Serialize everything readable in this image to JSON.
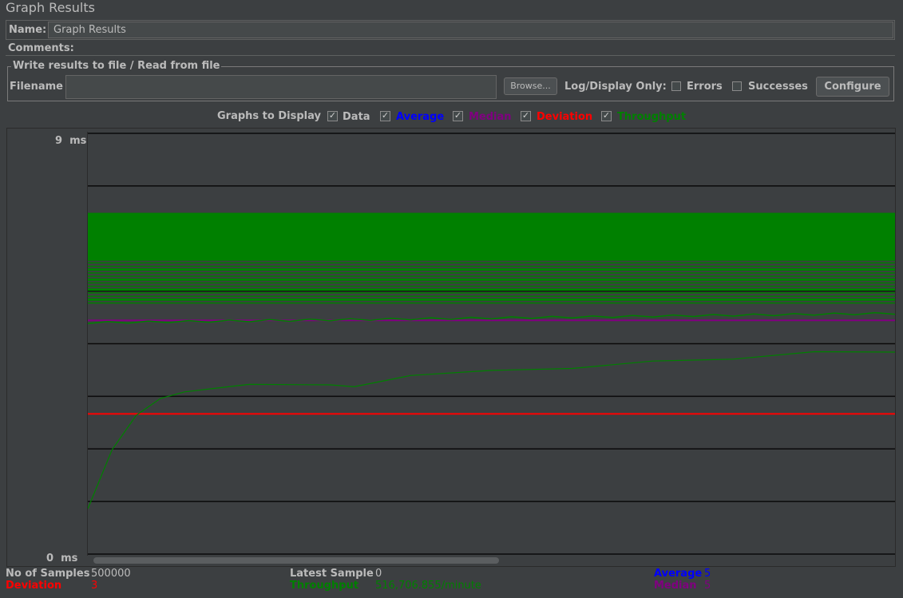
{
  "panel": {
    "title": "Graph Results",
    "name_label": "Name:",
    "name_value": "Graph Results",
    "comments_label": "Comments:"
  },
  "file": {
    "group_label": "Write results to file / Read from file",
    "filename_label": "Filename",
    "filename_value": "",
    "browse_label": "Browse...",
    "log_display_label": "Log/Display Only:",
    "errors_label": "Errors",
    "successes_label": "Successes",
    "configure_label": "Configure"
  },
  "display": {
    "label": "Graphs to Display",
    "options": [
      {
        "label": "Data",
        "checked": true,
        "color": "#bbbbbb"
      },
      {
        "label": "Average",
        "checked": true,
        "color": "#0000ff"
      },
      {
        "label": "Median",
        "checked": true,
        "color": "#800080"
      },
      {
        "label": "Deviation",
        "checked": true,
        "color": "#ff0000"
      },
      {
        "label": "Throughput",
        "checked": true,
        "color": "#008000"
      }
    ]
  },
  "chart_data": {
    "type": "line",
    "y_max_label": "9",
    "y_min_label": "0",
    "y_unit": "ms",
    "ylim": [
      0,
      9
    ],
    "grid_lines": 8,
    "series": [
      {
        "name": "Median",
        "color": "#800080",
        "constant": 5
      },
      {
        "name": "Deviation",
        "color": "#ff0000",
        "constant": 3
      },
      {
        "name": "Throughput",
        "color": "#008000",
        "x": [
          0,
          0.03,
          0.06,
          0.09,
          0.12,
          0.2,
          0.3,
          0.33,
          0.4,
          0.5,
          0.6,
          0.7,
          0.8,
          0.9,
          1.0
        ],
        "y": [
          1.0,
          2.2,
          3.0,
          3.3,
          3.5,
          3.6,
          3.65,
          3.55,
          3.85,
          3.9,
          4.0,
          4.1,
          4.2,
          4.3,
          4.35
        ]
      }
    ]
  },
  "stats": {
    "samples_label": "No of Samples",
    "samples_value": "500000",
    "latest_label": "Latest Sample",
    "latest_value": "0",
    "average_label": "Average",
    "average_value": "5",
    "deviation_label": "Deviation",
    "deviation_value": "3",
    "throughput_label": "Throughput",
    "throughput_value": "516,706.855/minute",
    "median_label": "Median",
    "median_value": "5"
  },
  "colors": {
    "background": "#3c3f41",
    "text": "#bbbbbb",
    "average": "#0000ff",
    "median": "#800080",
    "deviation": "#ff0000",
    "throughput": "#008000",
    "data": "#008000"
  }
}
